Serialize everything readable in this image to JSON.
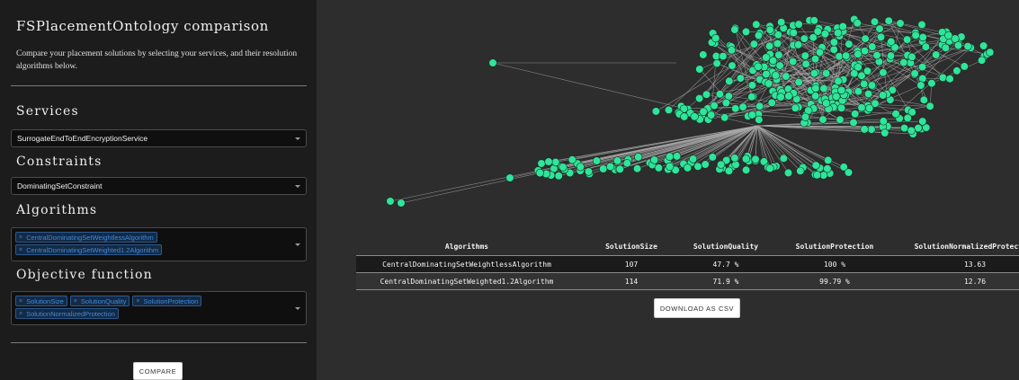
{
  "colors": {
    "node": "#2ee59a",
    "edge": "#a8a8a8",
    "accent": "#3b8ae0"
  },
  "sidebar": {
    "title": "FSPlacementOntology comparison",
    "description": "Compare your placement solutions by selecting your services, and their resolution algorithms below.",
    "services": {
      "label": "Services",
      "value": "SurrogateEndToEndEncryptionService"
    },
    "constraints": {
      "label": "Constraints",
      "value": "DominatingSetConstraint"
    },
    "algorithms": {
      "label": "Algorithms",
      "selected": [
        "CentralDominatingSetWeightlessAlgorithm",
        "CentralDominatingSetWeighted1.2Algorithm"
      ]
    },
    "objective": {
      "label": "Objective function",
      "selected": [
        "SolutionSize",
        "SolutionQuality",
        "SolutionProtection",
        "SolutionNormalizedProtection"
      ]
    },
    "compare_label": "COMPARE"
  },
  "results": {
    "columns": [
      "Algorithms",
      "SolutionSize",
      "SolutionQuality",
      "SolutionProtection",
      "SolutionNormalizedProtection"
    ],
    "rows": [
      [
        "CentralDominatingSetWeightlessAlgorithm",
        "107",
        "47.7 %",
        "100 %",
        "13.63"
      ],
      [
        "CentralDominatingSetWeighted1.2Algorithm",
        "114",
        "71.9 %",
        "99.79 %",
        "12.76"
      ]
    ],
    "download_label": "DOWNLOAD AS CSV"
  }
}
